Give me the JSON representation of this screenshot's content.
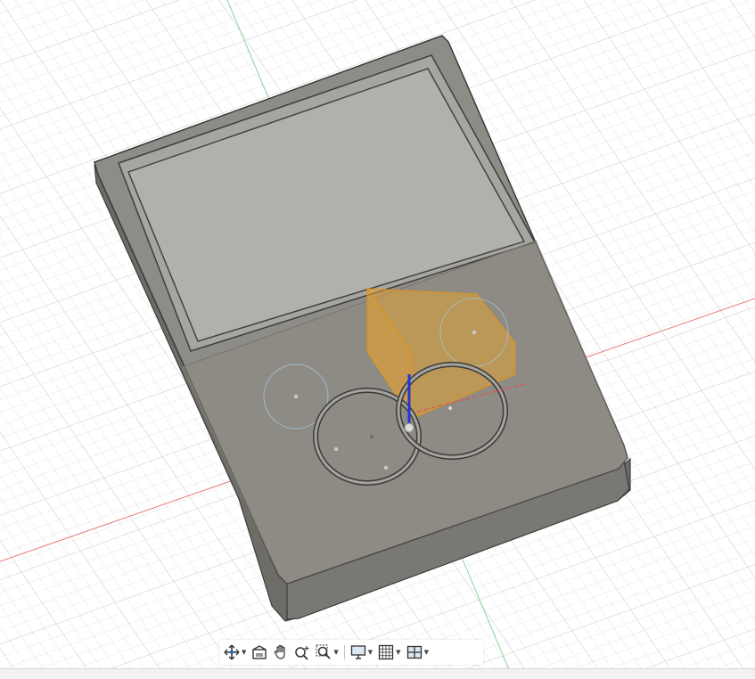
{
  "app": {
    "view": "3d-viewport",
    "body_color": "#8a8780",
    "plane_color": "#f5a623",
    "x_axis_color": "#e05555",
    "y_axis_color": "#55c06a",
    "z_axis_color": "#1f35e0"
  },
  "toolbar": {
    "tools": [
      {
        "name": "orbit",
        "icon": "orbit-icon",
        "has_dropdown": true
      },
      {
        "name": "look-at",
        "icon": "look-at-icon",
        "has_dropdown": false
      },
      {
        "name": "pan",
        "icon": "pan-hand-icon",
        "has_dropdown": false
      },
      {
        "name": "zoom",
        "icon": "zoom-icon",
        "has_dropdown": false
      },
      {
        "name": "fit",
        "icon": "zoom-window-icon",
        "has_dropdown": true
      },
      {
        "name": "display-settings",
        "icon": "display-settings-icon",
        "has_dropdown": true
      },
      {
        "name": "grid-snaps",
        "icon": "grid-icon",
        "has_dropdown": true
      },
      {
        "name": "viewports",
        "icon": "viewports-icon",
        "has_dropdown": true
      }
    ]
  }
}
